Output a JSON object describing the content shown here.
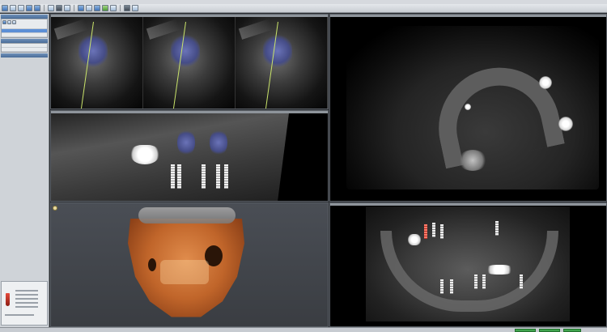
{
  "menu": {
    "items": [
      "",
      "",
      "",
      "",
      ""
    ]
  },
  "toolbar": {
    "icons": [
      "open-file-icon",
      "save-icon",
      "print-icon",
      "undo-icon",
      "redo-icon",
      "select-icon",
      "pan-icon",
      "zoom-icon",
      "measure-icon",
      "rotate-icon",
      "implant-icon",
      "nerve-icon",
      "crop-icon",
      "layout-icon",
      "settings-icon"
    ]
  },
  "sidebar": {
    "panels": [
      {
        "title": ""
      },
      {
        "title": ""
      },
      {
        "title": ""
      }
    ],
    "selected_row": 0
  },
  "viewports": {
    "cross_sections": {
      "count": 3
    },
    "axial": {},
    "sagittal": {},
    "render3d": {},
    "panoramic": {}
  },
  "status": {
    "text": ""
  },
  "colors": {
    "accent": "#5c8fd6",
    "roi": "#6a73b8",
    "guide": "#c9e36a",
    "bone_3d": "#c0652a",
    "status_ok": "#3fa34d"
  }
}
